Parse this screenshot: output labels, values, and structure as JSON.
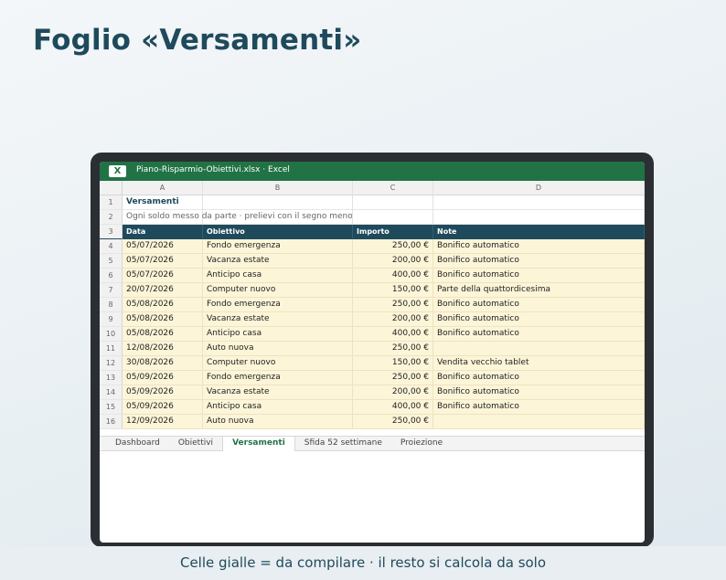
{
  "page": {
    "title": "Foglio «Versamenti»",
    "footer": "Celle gialle = da compilare · il resto si calcola da solo"
  },
  "window": {
    "file_title": "Piano-Risparmio-Obiettivi.xlsx · Excel",
    "app_icon_letter": "X",
    "accent_color": "#217346"
  },
  "sheet": {
    "columns": [
      "A",
      "B",
      "C",
      "D"
    ],
    "title_cell": "Versamenti",
    "subtitle_cell": "Ogni soldo messo da parte · prelievi con il segno meno",
    "headers": [
      "Data",
      "Obiettivo",
      "Importo",
      "Note"
    ],
    "header_color": "#1f4a5c",
    "input_cell_color": "#fdf5d8",
    "rows": [
      {
        "n": "4",
        "data": "05/07/2026",
        "obiettivo": "Fondo emergenza",
        "importo": "250,00 €",
        "note": "Bonifico automatico"
      },
      {
        "n": "5",
        "data": "05/07/2026",
        "obiettivo": "Vacanza estate",
        "importo": "200,00 €",
        "note": "Bonifico automatico"
      },
      {
        "n": "6",
        "data": "05/07/2026",
        "obiettivo": "Anticipo casa",
        "importo": "400,00 €",
        "note": "Bonifico automatico"
      },
      {
        "n": "7",
        "data": "20/07/2026",
        "obiettivo": "Computer nuovo",
        "importo": "150,00 €",
        "note": "Parte della quattordicesima"
      },
      {
        "n": "8",
        "data": "05/08/2026",
        "obiettivo": "Fondo emergenza",
        "importo": "250,00 €",
        "note": "Bonifico automatico"
      },
      {
        "n": "9",
        "data": "05/08/2026",
        "obiettivo": "Vacanza estate",
        "importo": "200,00 €",
        "note": "Bonifico automatico"
      },
      {
        "n": "10",
        "data": "05/08/2026",
        "obiettivo": "Anticipo casa",
        "importo": "400,00 €",
        "note": "Bonifico automatico"
      },
      {
        "n": "11",
        "data": "12/08/2026",
        "obiettivo": "Auto nuova",
        "importo": "250,00 €",
        "note": ""
      },
      {
        "n": "12",
        "data": "30/08/2026",
        "obiettivo": "Computer nuovo",
        "importo": "150,00 €",
        "note": "Vendita vecchio tablet"
      },
      {
        "n": "13",
        "data": "05/09/2026",
        "obiettivo": "Fondo emergenza",
        "importo": "250,00 €",
        "note": "Bonifico automatico"
      },
      {
        "n": "14",
        "data": "05/09/2026",
        "obiettivo": "Vacanza estate",
        "importo": "200,00 €",
        "note": "Bonifico automatico"
      },
      {
        "n": "15",
        "data": "05/09/2026",
        "obiettivo": "Anticipo casa",
        "importo": "400,00 €",
        "note": "Bonifico automatico"
      },
      {
        "n": "16",
        "data": "12/09/2026",
        "obiettivo": "Auto nuova",
        "importo": "250,00 €",
        "note": ""
      }
    ],
    "tabs": [
      {
        "label": "Dashboard",
        "active": false
      },
      {
        "label": "Obiettivi",
        "active": false
      },
      {
        "label": "Versamenti",
        "active": true
      },
      {
        "label": "Sfida 52 settimane",
        "active": false
      },
      {
        "label": "Proiezione",
        "active": false
      }
    ]
  }
}
